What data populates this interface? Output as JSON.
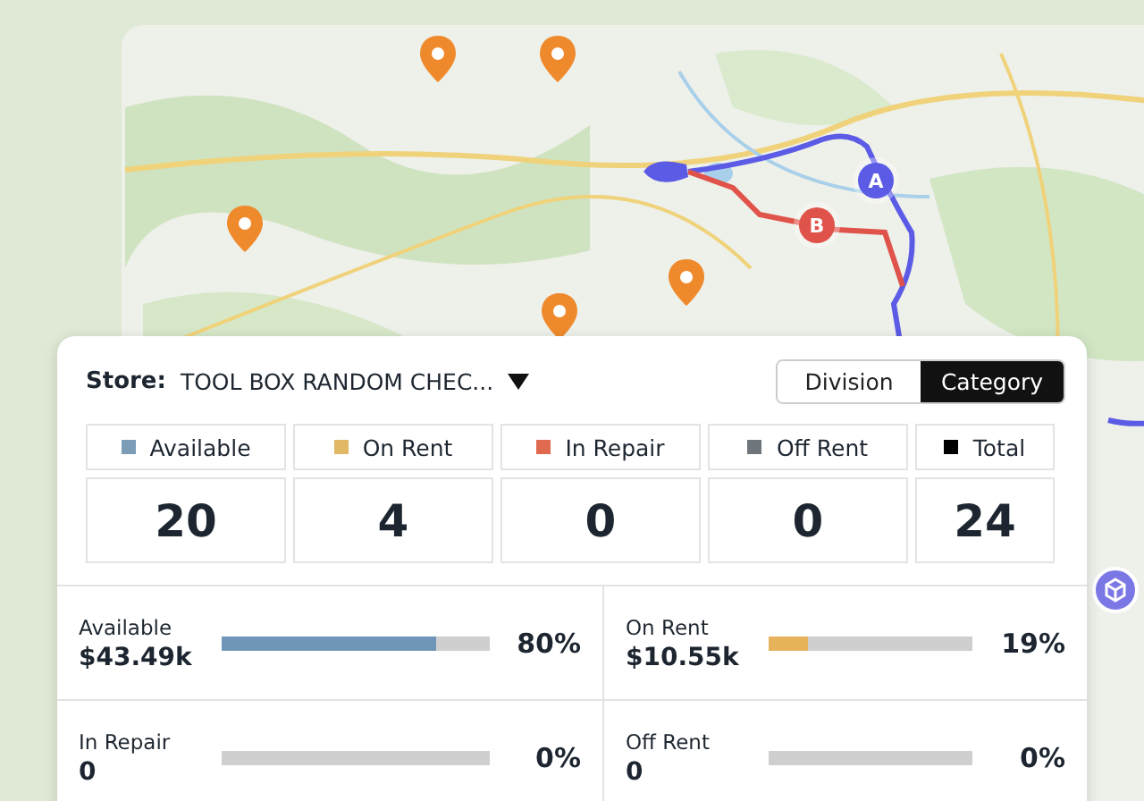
{
  "map": {
    "route_markers": [
      {
        "label": "A",
        "color": "#5b5be6"
      },
      {
        "label": "B",
        "color": "#e0534a"
      }
    ]
  },
  "store": {
    "label": "Store:",
    "value": "TOOL BOX RANDOM CHEC..."
  },
  "view_toggle": [
    {
      "label": "Division",
      "selected": false
    },
    {
      "label": "Category",
      "selected": true
    }
  ],
  "counts": [
    {
      "label": "Available",
      "color": "#7c9cb8",
      "value": "20"
    },
    {
      "label": "On Rent",
      "color": "#e0b866",
      "value": "4"
    },
    {
      "label": "In Repair",
      "color": "#e06a50",
      "value": "0"
    },
    {
      "label": "Off Rent",
      "color": "#6e757b",
      "value": "0"
    },
    {
      "label": "Total",
      "color": "#000000",
      "value": "24"
    }
  ],
  "metrics": [
    {
      "label": "Available",
      "value": "$43.49k",
      "level": 0.8,
      "color": "#6f96b8",
      "reading": "80%"
    },
    {
      "label": "On Rent",
      "value": "$10.55k",
      "level": 0.19,
      "color": "#e6b35a",
      "reading": "19%"
    },
    {
      "label": "In Repair",
      "value": "0",
      "level": 0,
      "reading": "0%"
    },
    {
      "label": "Off Rent",
      "value": "0",
      "level": 0,
      "reading": "0%"
    }
  ]
}
